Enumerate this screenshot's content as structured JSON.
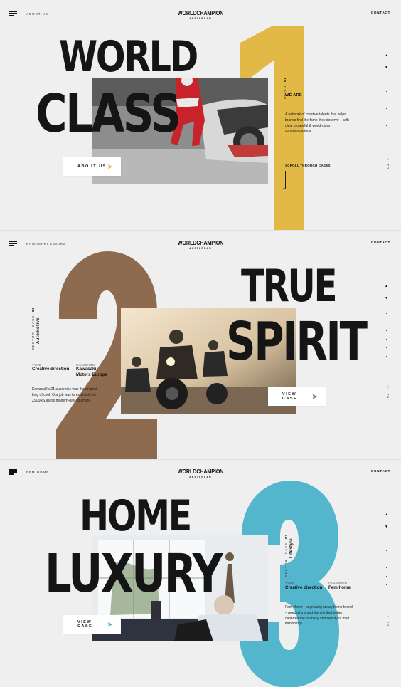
{
  "brand": {
    "name": "WORLDCHAMPION",
    "sub": "AMSTERDAM"
  },
  "contact_label": "CONTACT",
  "slides": [
    {
      "nav_label": "ABOUT US",
      "number": "1",
      "number_color": "#e2b946",
      "headline_top": "WORLD",
      "headline_bottom": "CLASS",
      "button_label": "ABOUT US",
      "button_arrow_color": "#e2b946",
      "intro_label": "INTRO",
      "intro_num": "01",
      "we_are": "WE ARE",
      "description": "A network of creative talents that helps brands find the fame they deserve – with clear, powerful & world-class communications.",
      "scroll_label": "SCROLL THROUGH CASES",
      "pager_current": "01",
      "pager_total": "07"
    },
    {
      "nav_label": "KAWASAKI Z900RS",
      "number": "2",
      "number_color": "#8e6a4e",
      "headline_top": "TRUE",
      "headline_bottom": "SPIRIT",
      "button_label": "VIEW CASE",
      "button_arrow_color": "#8e6a4e",
      "sector_label": "SECTOR · CASE",
      "sector_num": "02",
      "sector_value": "Automotive",
      "type_label": "TYPE",
      "type_value": "Creative direction",
      "champion_label": "CHAMPION",
      "champion_value": "Kawasaki Motors Europe",
      "description": "Kawasaki's Z1 superbike was the original king of cool. Our job was to establish the Z900RS as it's modern-day soulmate.",
      "pager_current": "02",
      "pager_total": "07"
    },
    {
      "nav_label": "FEM HOME",
      "number": "3",
      "number_color": "#54b6cc",
      "headline_top": "HOME",
      "headline_bottom": "LUXURY",
      "button_label": "VIEW CASE",
      "button_arrow_color": "#54b6cc",
      "sector_label": "SECTOR · CASE",
      "sector_num": "03",
      "sector_value": "Lifestyle",
      "type_label": "TYPE",
      "type_value": "Creative direction",
      "champion_label": "CHAMPION",
      "champion_value": "Fem home",
      "description": "Fem Home – a growing luxury home brand – needed a brand identity that better captured the intimacy and beauty of their furnishings.",
      "pager_current": "03",
      "pager_total": "07"
    }
  ]
}
